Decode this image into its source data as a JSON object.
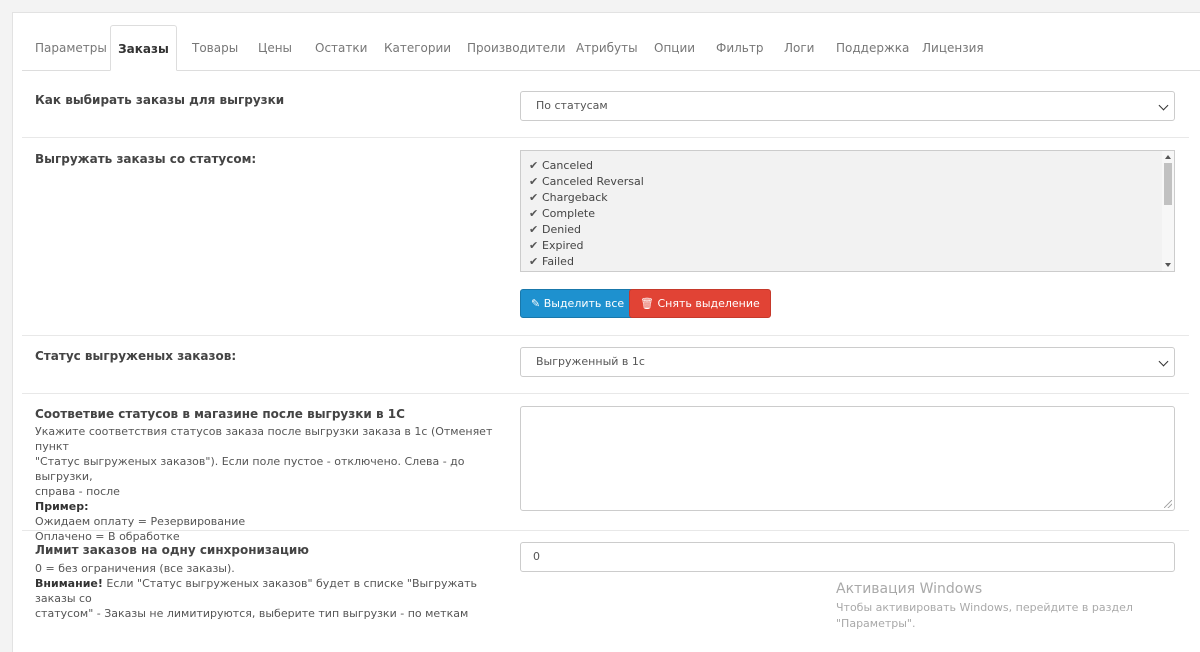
{
  "tabs": [
    "Параметры",
    "Заказы",
    "Товары",
    "Цены",
    "Остатки",
    "Категории",
    "Производители",
    "Атрибуты",
    "Опции",
    "Фильтр",
    "Логи",
    "Поддержка",
    "Лицензия"
  ],
  "active_tab": "Заказы",
  "row_select_mode": {
    "label": "Как выбирать заказы для выгрузки",
    "value": "По статусам"
  },
  "row_statuses": {
    "label": "Выгружать заказы со статусом:",
    "items": [
      "Canceled",
      "Canceled Reversal",
      "Chargeback",
      "Complete",
      "Denied",
      "Expired",
      "Failed"
    ],
    "select_all_label": "Выделить все",
    "deselect_label": "Снять выделение"
  },
  "row_exported_status": {
    "label": "Статус выгруженых заказов:",
    "value": "Выгруженный в 1с"
  },
  "row_mapping": {
    "label": "Соответвие статусов в магазине после выгрузки в 1С",
    "help_line1": "Укажите соответствия статусов заказа после выгрузки заказа в 1с (Отменяет пункт",
    "help_line2": "\"Статус выгруженых заказов\"). Если поле пустое - отключено. Слева - до выгрузки,",
    "help_line3": "справа - после",
    "example_label": "Пример:",
    "example_line1": "Ожидаем оплату = Резервирование",
    "example_line2": "Оплачено = В обработке"
  },
  "row_limit": {
    "label": "Лимит заказов на одну синхронизацию",
    "value": "0",
    "help_line1": "0 = без ограничения (все заказы).",
    "attention_label": "Внимание!",
    "help_line2": " Если \"Статус выгруженых заказов\" будет в списке \"Выгружать заказы со",
    "help_line3": "статусом\" - Заказы не лимитируются, выберите тип выгрузки - по меткам"
  },
  "watermark": {
    "title": "Активация Windows",
    "subtitle": "Чтобы активировать Windows, перейдите в раздел \"Параметры\"."
  }
}
